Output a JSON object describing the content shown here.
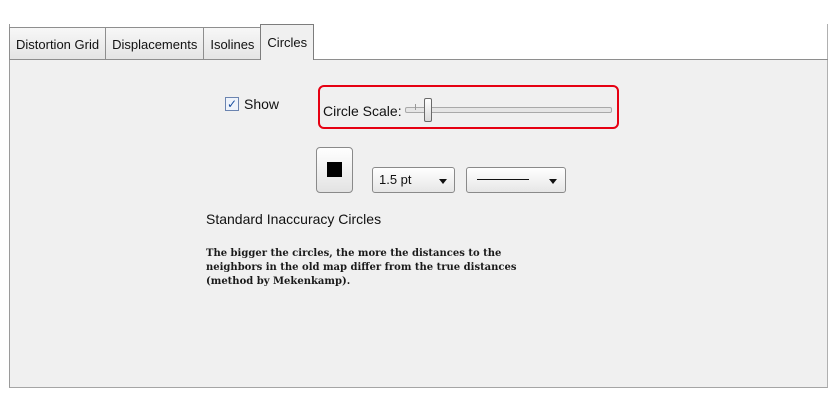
{
  "tabs": [
    {
      "label": "Distortion Grid",
      "active": false
    },
    {
      "label": "Displacements",
      "active": false
    },
    {
      "label": "Isolines",
      "active": false
    },
    {
      "label": "Circles",
      "active": true
    }
  ],
  "show": {
    "label": "Show",
    "checked": true
  },
  "circle_scale": {
    "label": "Circle Scale:",
    "value_fraction": 0.12
  },
  "line": {
    "color": "#000000",
    "width_value": "1.5 pt",
    "style_value": "solid line"
  },
  "heading": "Standard Inaccuracy Circles",
  "description": [
    "The bigger the circles, the more the distances to the",
    "neighbors in the old map differ from the true distances",
    "(method by Mekenkamp)."
  ],
  "highlight_color": "#e60012"
}
